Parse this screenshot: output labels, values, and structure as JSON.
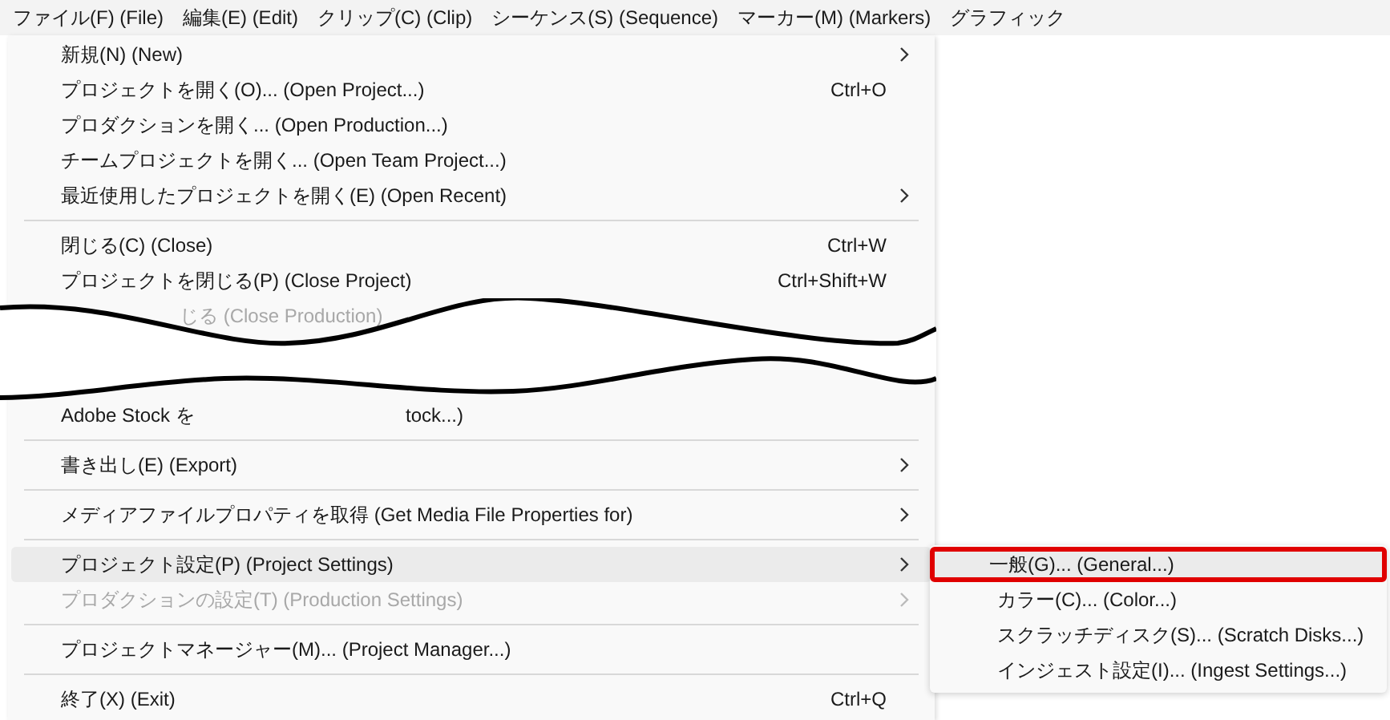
{
  "menubar": [
    {
      "label": "ファイル(F) (File)"
    },
    {
      "label": "編集(E) (Edit)"
    },
    {
      "label": "クリップ(C) (Clip)"
    },
    {
      "label": "シーケンス(S) (Sequence)"
    },
    {
      "label": "マーカー(M) (Markers)"
    },
    {
      "label": "グラフィック"
    }
  ],
  "menu": {
    "items": [
      {
        "kind": "item",
        "label": "新規(N) (New)",
        "submenu": true,
        "disabled": false,
        "highlighted": false
      },
      {
        "kind": "item",
        "label": "プロジェクトを開く(O)... (Open Project...)",
        "shortcut": "Ctrl+O",
        "submenu": false,
        "disabled": false,
        "highlighted": false
      },
      {
        "kind": "item",
        "label": "プロダクションを開く... (Open Production...)",
        "submenu": false,
        "disabled": false,
        "highlighted": false
      },
      {
        "kind": "item",
        "label": "チームプロジェクトを開く... (Open Team Project...)",
        "submenu": false,
        "disabled": false,
        "highlighted": false
      },
      {
        "kind": "item",
        "label": "最近使用したプロジェクトを開く(E) (Open Recent)",
        "submenu": true,
        "disabled": false,
        "highlighted": false
      },
      {
        "kind": "separator"
      },
      {
        "kind": "item",
        "label": "閉じる(C) (Close)",
        "shortcut": "Ctrl+W",
        "submenu": false,
        "disabled": false,
        "highlighted": false
      },
      {
        "kind": "item",
        "label": "プロジェクトを閉じる(P) (Close Project)",
        "shortcut": "Ctrl+Shift+W",
        "submenu": false,
        "disabled": false,
        "highlighted": false
      },
      {
        "kind": "break",
        "top": "じる (Close Production)",
        "bottom_left": "Adobe Stock を",
        "bottom_right": "tock...)"
      },
      {
        "kind": "separator"
      },
      {
        "kind": "item",
        "label": "書き出し(E) (Export)",
        "submenu": true,
        "disabled": false,
        "highlighted": false
      },
      {
        "kind": "separator"
      },
      {
        "kind": "item",
        "label": "メディアファイルプロパティを取得 (Get Media File Properties for)",
        "submenu": true,
        "disabled": false,
        "highlighted": false
      },
      {
        "kind": "separator"
      },
      {
        "kind": "item",
        "label": "プロジェクト設定(P) (Project Settings)",
        "submenu": true,
        "disabled": false,
        "highlighted": true
      },
      {
        "kind": "item",
        "label": "プロダクションの設定(T) (Production Settings)",
        "submenu": true,
        "disabled": true,
        "highlighted": false
      },
      {
        "kind": "separator"
      },
      {
        "kind": "item",
        "label": "プロジェクトマネージャー(M)... (Project Manager...)",
        "submenu": false,
        "disabled": false,
        "highlighted": false
      },
      {
        "kind": "separator"
      },
      {
        "kind": "item",
        "label": "終了(X) (Exit)",
        "shortcut": "Ctrl+Q",
        "submenu": false,
        "disabled": false,
        "highlighted": false
      }
    ]
  },
  "submenu": {
    "items": [
      {
        "label": "一般(G)... (General...)",
        "highlighted": true,
        "annotated": true
      },
      {
        "label": "カラー(C)... (Color...)",
        "highlighted": false,
        "annotated": false
      },
      {
        "label": "スクラッチディスク(S)... (Scratch Disks...)",
        "highlighted": false,
        "annotated": false
      },
      {
        "label": "インジェスト設定(I)... (Ingest Settings...)",
        "highlighted": false,
        "annotated": false
      }
    ]
  }
}
